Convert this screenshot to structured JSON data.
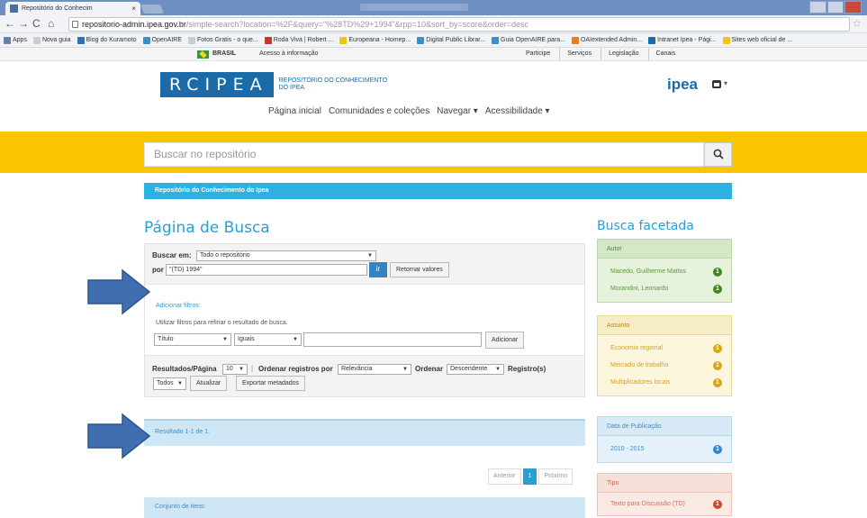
{
  "browser": {
    "tab_title": "Repositório do Conhecim",
    "url_host": "repositorio-admin.ipea.gov.br",
    "url_path": "/simple-search?location=%2F&query=\"%28TD%29+1994\"&rpp=10&sort_by=score&order=desc",
    "bookmarks": [
      {
        "label": "Apps",
        "color": "#6a7fa8"
      },
      {
        "label": "Nova guia",
        "color": "#cccccc"
      },
      {
        "label": "Blog do Kuramoto",
        "color": "#2e6fb5"
      },
      {
        "label": "OpenAIRE",
        "color": "#3b8fc7"
      },
      {
        "label": "Fotos Gratis - o que...",
        "color": "#cccccc"
      },
      {
        "label": "Roda Viva | Robert ...",
        "color": "#c0392b"
      },
      {
        "label": "Europeana - Homep...",
        "color": "#f0c419"
      },
      {
        "label": "Digital Public Librar...",
        "color": "#3b8fc7"
      },
      {
        "label": "Guia OpenAIRE para...",
        "color": "#3b8fc7"
      },
      {
        "label": "OAIextended Admin...",
        "color": "#e67e22"
      },
      {
        "label": "Intranet Ipea - Pági...",
        "color": "#1a6ba8"
      },
      {
        "label": "Sites web oficial de ...",
        "color": "#f0c419"
      }
    ]
  },
  "govbar": {
    "brasil": "BRASIL",
    "info": "Acesso à informação",
    "links": [
      "Participe",
      "Serviços",
      "Legislação",
      "Canais"
    ]
  },
  "header": {
    "logo_text": "RCIPEA",
    "logo_sub_1": "REPOSITÓRIO DO CONHECIMENTO",
    "logo_sub_2": "DO IPEA",
    "ipea_logo": "ipea",
    "nav": [
      "Página inicial",
      "Comunidades e coleções",
      "Navegar ▾",
      "Acessibilidade ▾"
    ]
  },
  "search": {
    "placeholder": "Buscar no repositório"
  },
  "breadcrumb": "Repositório do Conhecimento do Ipea",
  "page_title": "Página de Busca",
  "form": {
    "search_in_label": "Buscar em:",
    "search_in_value": "Todo o repositório",
    "por_label": "por",
    "query_value": "\"(TD) 1994\"",
    "go_label": "ir",
    "reset_label": "Retornar valores",
    "add_filters_link": "Adicionar filtros:",
    "filters_help": "Utilizar filtros para refinar o resultado de busca.",
    "filter_field": "Título",
    "filter_op": "Iguais",
    "filter_value": "",
    "add_label": "Adicionar",
    "results_per_page_label": "Resultados/Página",
    "results_per_page": "10",
    "sort_by_label": "Ordenar registros por",
    "sort_by": "Relevância",
    "order_label": "Ordenar",
    "order": "Descendente",
    "records_label": "Registro(s)",
    "records": "Todos",
    "update_label": "Atualizar",
    "export_label": "Exportar metadados"
  },
  "results": {
    "summary": "Resultado 1-1 de 1.",
    "prev": "Anterior",
    "page": "1",
    "next": "Próximo",
    "item_set": "Conjunto de itens:"
  },
  "facets": {
    "title": "Busca facetada",
    "groups": [
      {
        "head": "Autor",
        "color": "green",
        "items": [
          {
            "label": "Macedo, Guilherme Mattos",
            "count": "1"
          },
          {
            "label": "Morandini, Leonardo",
            "count": "1"
          }
        ]
      },
      {
        "head": "Assunto",
        "color": "yellow",
        "items": [
          {
            "label": "Economia regional",
            "count": "1"
          },
          {
            "label": "Mercado de trabalho",
            "count": "1"
          },
          {
            "label": "Multiplicadores locais",
            "count": "1"
          }
        ]
      },
      {
        "head": "Data de Publicação",
        "color": "blue",
        "items": [
          {
            "label": "2010 - 2015",
            "count": "1"
          }
        ]
      },
      {
        "head": "Tipo",
        "color": "red",
        "items": [
          {
            "label": "Texto para Discussão (TD)",
            "count": "1"
          }
        ]
      }
    ]
  },
  "colors": {
    "yellow_band": "#f8c500",
    "accent_blue": "#2a9fd4",
    "arrow_blue": "#3f6fb0"
  }
}
